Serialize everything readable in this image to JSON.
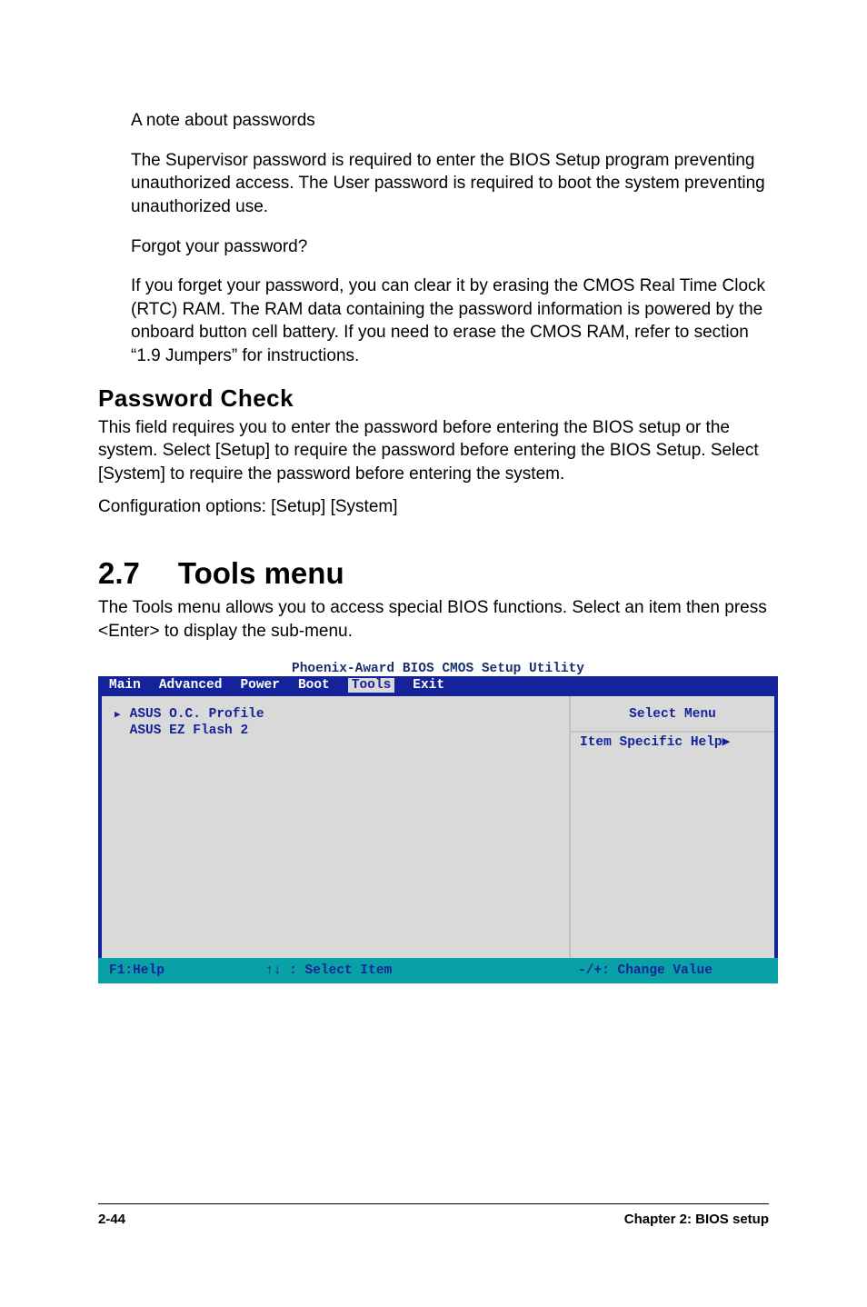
{
  "para1_title": "A note about passwords",
  "para1_body": "The Supervisor password is required to enter the BIOS Setup program preventing unauthorized access. The User password is required to boot the system preventing unauthorized use.",
  "para2_title": "Forgot your password?",
  "para2_body": "If you forget your password, you can clear it by erasing the CMOS Real Time Clock (RTC) RAM. The RAM data containing the password information is powered by the onboard button cell battery. If you need to erase the CMOS RAM, refer to section “1.9 Jumpers” for instructions.",
  "pwcheck_title": "Password Check",
  "pwcheck_body": "This field requires you to enter the password before entering the BIOS setup or the system. Select [Setup] to require the password before entering the BIOS Setup. Select [System] to require the password before entering the system.",
  "pwcheck_cfg": "Configuration options: [Setup] [System]",
  "section_num": "2.7",
  "section_title": "Tools menu",
  "section_body": "The Tools menu allows you to access special BIOS functions. Select an item then press <Enter> to display the sub-menu.",
  "bios": {
    "title": "Phoenix-Award BIOS CMOS Setup Utility",
    "menu": [
      "Main",
      "Advanced",
      "Power",
      "Boot",
      "Tools",
      "Exit"
    ],
    "selected_menu_index": 4,
    "items": [
      {
        "label": "ASUS O.C. Profile",
        "arrow": true
      },
      {
        "label": "ASUS EZ Flash 2",
        "arrow": false
      }
    ],
    "right_title": "Select Menu",
    "right_help": "Item Specific Help",
    "foot": {
      "f1": "F1:Help",
      "select": " : Select Item",
      "change": "-/+: Change Value"
    }
  },
  "footer": {
    "left": "2-44",
    "right": "Chapter 2: BIOS setup"
  }
}
